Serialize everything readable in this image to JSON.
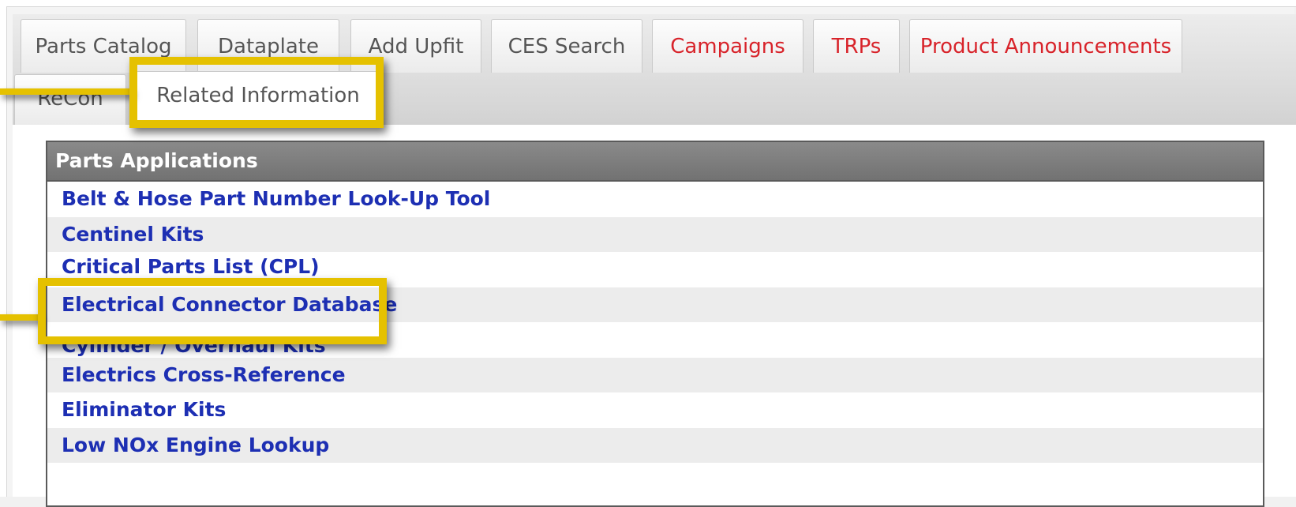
{
  "tabs_row1": [
    {
      "label": "Parts Catalog",
      "color": "default"
    },
    {
      "label": "Dataplate",
      "color": "default"
    },
    {
      "label": "Add Upfit",
      "color": "default"
    },
    {
      "label": "CES Search",
      "color": "default"
    },
    {
      "label": "Campaigns",
      "color": "red"
    },
    {
      "label": "TRPs",
      "color": "red"
    },
    {
      "label": "Product Announcements",
      "color": "red"
    }
  ],
  "tabs_row2": [
    {
      "label": "ReCon"
    },
    {
      "label": "Related Information",
      "active": true
    }
  ],
  "section": {
    "title": "Parts Applications",
    "items": [
      "Belt & Hose Part Number Look-Up Tool",
      "Centinel Kits",
      "Critical Parts List (CPL)",
      "Electrical Connector Database",
      "Cylinder / Overhaul Kits",
      "Electrics Cross-Reference",
      "Eliminator Kits",
      "Low NOx Engine Lookup"
    ]
  },
  "colors": {
    "link": "#1d2fb3",
    "red_tab": "#d8232a",
    "highlight": "#e5c100",
    "header_bg": "#7d7d7d"
  }
}
